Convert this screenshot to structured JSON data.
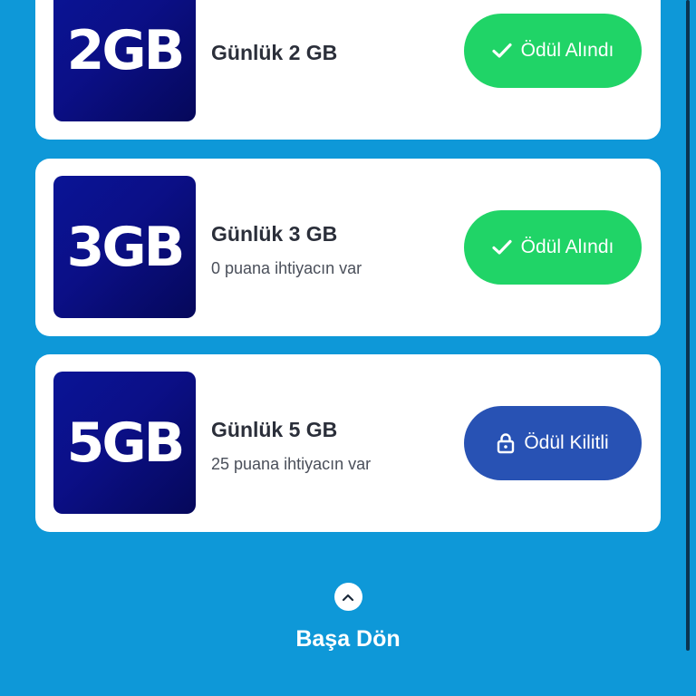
{
  "rewards": [
    {
      "badge": "2GB",
      "title": "Günlük 2 GB",
      "subtitle": "",
      "button_label": "Ödül Alındı",
      "button_icon": "check-icon",
      "status": "claimed"
    },
    {
      "badge": "3GB",
      "title": "Günlük 3 GB",
      "subtitle": "0 puana ihtiyacın var",
      "button_label": "Ödül Alındı",
      "button_icon": "check-icon",
      "status": "claimed"
    },
    {
      "badge": "5GB",
      "title": "Günlük 5 GB",
      "subtitle": "25 puana ihtiyacın var",
      "button_label": "Ödül Kilitli",
      "button_icon": "lock-icon",
      "status": "locked"
    }
  ],
  "back_to_top": {
    "label": "Başa Dön",
    "icon": "chevron-up-icon"
  },
  "colors": {
    "background": "#0e98d8",
    "card": "#ffffff",
    "badge_bg": "#0a1496",
    "claimed_button": "#20d467",
    "locked_button": "#2852b4",
    "title_text": "#2b2f3a",
    "subtitle_text": "#4a4f5a"
  }
}
